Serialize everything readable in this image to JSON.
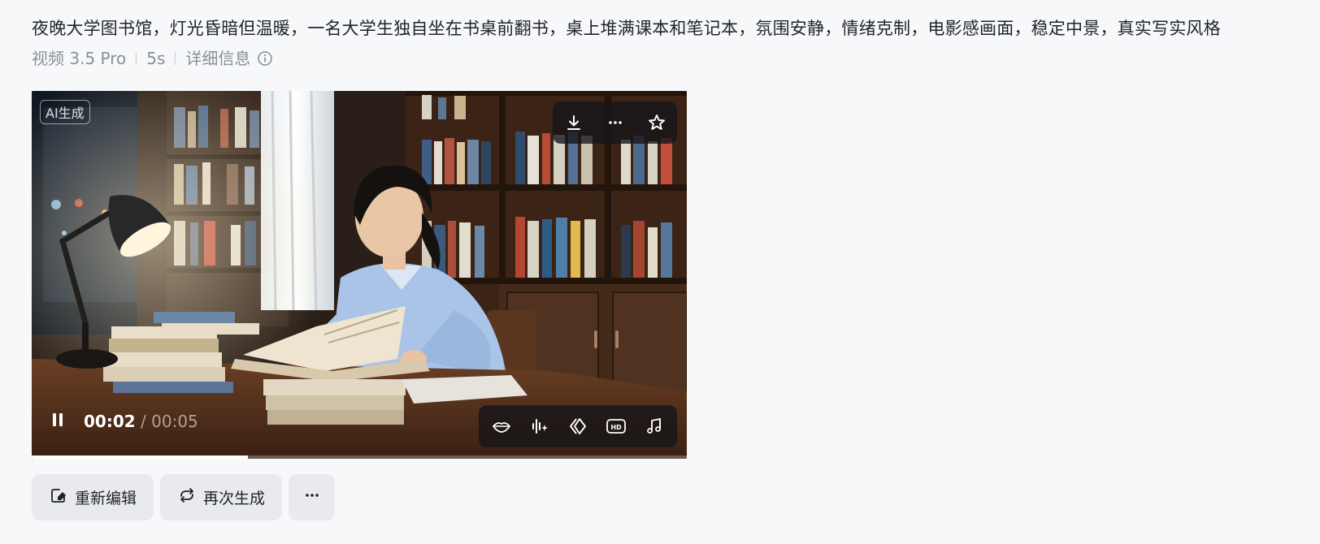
{
  "prompt": {
    "text": "夜晚大学图书馆，灯光昏暗但温暖，一名大学生独自坐在书桌前翻书，桌上堆满课本和笔记本，氛围安静，情绪克制，电影感画面，稳定中景，真实写实风格"
  },
  "meta": {
    "model": "视频 3.5 Pro",
    "duration": "5s",
    "details_label": "详细信息",
    "details_icon": "info-circle-icon"
  },
  "video": {
    "badge": "AI生成",
    "top_actions": [
      "download-icon",
      "more-horizontal-icon",
      "star-icon"
    ],
    "current_time": "00:02",
    "time_separator": " / ",
    "total_time": "00:05",
    "progress_fraction": 0.33,
    "bottom_tools": [
      "lips-icon",
      "voice-sparkle-icon",
      "diamond-transition-icon",
      "hd-icon",
      "music-note-icon"
    ],
    "play_state_icon": "pause-icon"
  },
  "actions": {
    "reedit_label": "重新编辑",
    "regenerate_label": "再次生成",
    "more_icon": "more-horizontal-icon"
  },
  "colors": {
    "background": "#f7f8fa",
    "text": "#1f2329",
    "muted": "#8a8f99",
    "button_bg": "#e9eaed",
    "overlay": "#141418"
  }
}
